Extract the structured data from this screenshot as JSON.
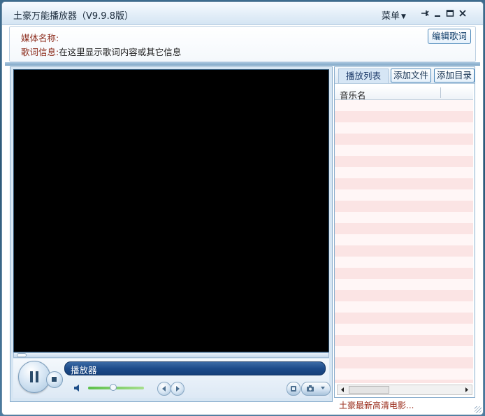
{
  "window": {
    "title": "土豪万能播放器（V9.9.8版）",
    "menu_label": "菜单",
    "controls": {
      "pin_icon": "pin-icon",
      "minimize_icon": "minimize-icon",
      "maximize_icon": "maximize-icon",
      "close_icon": "close-icon"
    }
  },
  "info": {
    "media_name_label": "媒体名称:",
    "media_name_value": "",
    "lyrics_label": "歌词信息:",
    "lyrics_value": "在这里显示歌词内容或其它信息",
    "edit_lyrics_button": "编辑歌词"
  },
  "player": {
    "status_text": "播放器",
    "volume_level": 0.45,
    "buttons": {
      "play_pause_icon": "pause-icon",
      "stop_icon": "stop-icon",
      "speaker_icon": "speaker-icon",
      "prev_icon": "previous-icon",
      "next_icon": "next-icon",
      "fullscreen_icon": "fullscreen-icon",
      "snapshot_icon": "snapshot-icon",
      "dropdown_icon": "chevron-down-icon"
    }
  },
  "playlist": {
    "tab_label": "播放列表",
    "add_file_button": "添加文件",
    "add_folder_button": "添加目录",
    "column_header": "音乐名",
    "items": []
  },
  "footer": {
    "promo_link": "土豪最新高清电影..."
  },
  "colors": {
    "accent_blue": "#1c4b8a",
    "label_red": "#8b2a1a",
    "playlist_stripe_a": "#fff6f6",
    "playlist_stripe_b": "#fbe4e4"
  }
}
